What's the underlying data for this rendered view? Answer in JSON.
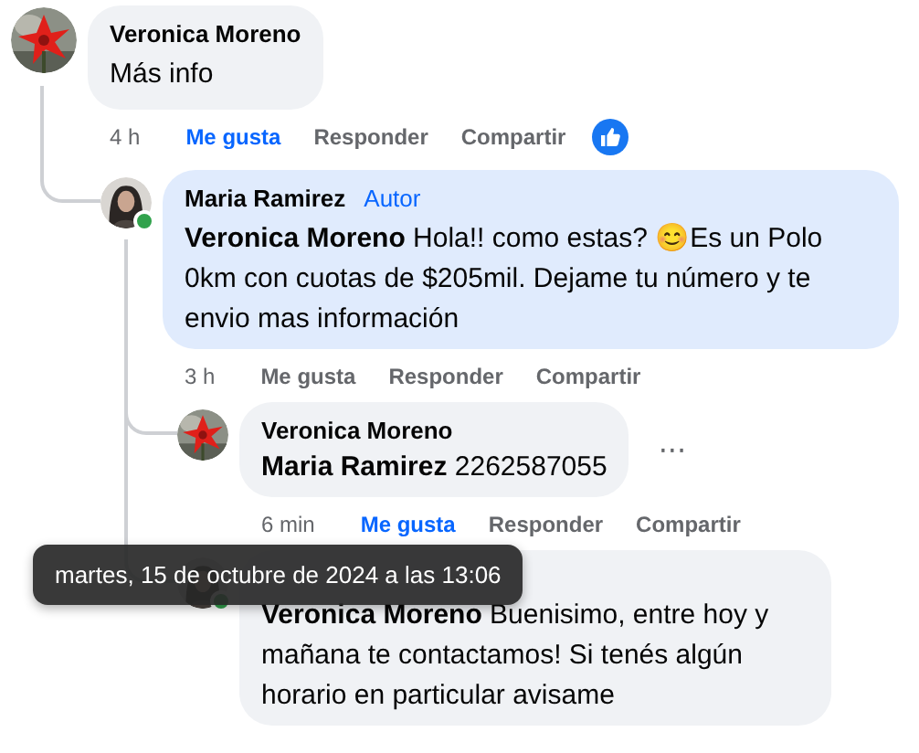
{
  "comments": [
    {
      "author": "Veronica Moreno",
      "avatar": {
        "kind": "flower"
      },
      "online": false,
      "highlighted": false,
      "text": "Más info",
      "time": "4 h",
      "actions": [
        "Me gusta",
        "Responder",
        "Compartir"
      ],
      "liked": true,
      "reaction": {
        "kind": "like"
      },
      "replies": [
        {
          "author": "Maria Ramirez",
          "badge": "Autor",
          "avatar": {
            "kind": "person"
          },
          "online": true,
          "highlighted": true,
          "text": "**Veronica Moreno** Hola!! como estas? 😊Es un Polo 0km con cuotas de $205mil. Dejame tu número y te envio mas información",
          "time": "3 h",
          "actions": [
            "Me gusta",
            "Responder",
            "Compartir"
          ],
          "liked": false,
          "replies": [
            {
              "author": "Veronica Moreno",
              "avatar": {
                "kind": "flower"
              },
              "online": false,
              "highlighted": false,
              "text": "**Maria Ramirez** 2262587055",
              "menu": "···",
              "time": "6 min",
              "actions": [
                "Me gusta",
                "Responder",
                "Compartir"
              ],
              "liked": true
            },
            {
              "avatar": {
                "kind": "person"
              },
              "online": true,
              "highlighted": false,
              "text": "**Veronica Moreno** Buenisimo, entre hoy y mañana te contactamos! Si tenés algún horario en particular avisame"
            }
          ]
        }
      ]
    }
  ],
  "tooltip": "martes, 15 de octubre de 2024 a las 13:06"
}
